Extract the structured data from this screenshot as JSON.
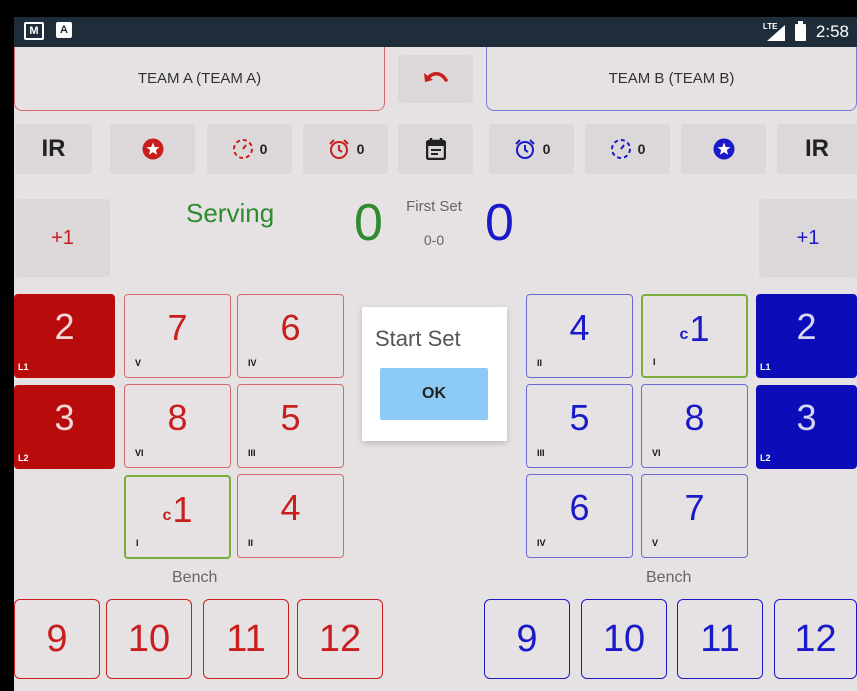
{
  "status_bar": {
    "time": "2:58",
    "network": "LTE",
    "app_icon_letter": "A"
  },
  "teams": {
    "a": {
      "name": "TEAM A (TEAM A)"
    },
    "b": {
      "name": "TEAM B (TEAM B)"
    }
  },
  "controls": {
    "ir_label": "IR",
    "team_a_timeouts": "0",
    "team_a_challenges": "0",
    "team_b_timeouts": "0",
    "team_b_challenges": "0"
  },
  "score": {
    "plus_label": "+1",
    "serving_label": "Serving",
    "team_a": "0",
    "team_b": "0",
    "set_name": "First Set",
    "set_score": "0-0"
  },
  "court_a": {
    "liberos": [
      {
        "number": "2",
        "tag": "L1"
      },
      {
        "number": "3",
        "tag": "L2"
      }
    ],
    "positions": [
      {
        "number": "7",
        "pos": "V"
      },
      {
        "number": "6",
        "pos": "IV"
      },
      {
        "number": "8",
        "pos": "VI"
      },
      {
        "number": "5",
        "pos": "III"
      },
      {
        "number": "1",
        "pos": "I",
        "captain": "c"
      },
      {
        "number": "4",
        "pos": "II"
      }
    ]
  },
  "court_b": {
    "liberos": [
      {
        "number": "2",
        "tag": "L1"
      },
      {
        "number": "3",
        "tag": "L2"
      }
    ],
    "positions": [
      {
        "number": "4",
        "pos": "II"
      },
      {
        "number": "1",
        "pos": "I",
        "captain": "c"
      },
      {
        "number": "5",
        "pos": "III"
      },
      {
        "number": "8",
        "pos": "VI"
      },
      {
        "number": "6",
        "pos": "IV"
      },
      {
        "number": "7",
        "pos": "V"
      }
    ]
  },
  "bench": {
    "label": "Bench",
    "team_a": [
      "9",
      "10",
      "11",
      "12"
    ],
    "team_b": [
      "9",
      "10",
      "11",
      "12"
    ]
  },
  "dialog": {
    "title": "Start Set",
    "ok_label": "OK"
  },
  "colors": {
    "team_a": "#c81e1e",
    "team_b": "#1a1ac8",
    "serving": "#2e8b2e",
    "dialog_button": "#8ccbf5"
  }
}
